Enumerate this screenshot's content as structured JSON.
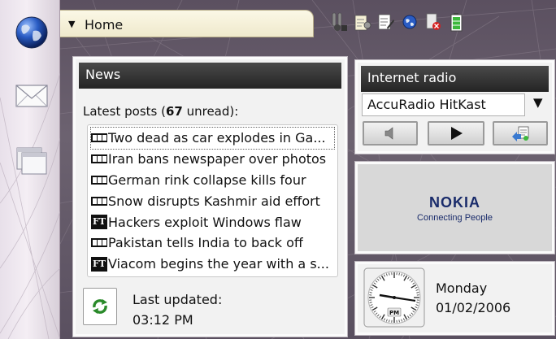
{
  "header": {
    "title": "Home"
  },
  "taskbar": {
    "items": [
      {
        "icon": "globe-icon"
      },
      {
        "icon": "mail-icon"
      },
      {
        "icon": "windows-icon"
      }
    ]
  },
  "toolbar": {
    "icons": [
      "connection-settings-icon",
      "device-settings-icon",
      "edit-icon",
      "globe-icon",
      "disconnect-icon",
      "battery-icon"
    ]
  },
  "news": {
    "title": "News",
    "latest_prefix": "Latest posts (",
    "unread_count": "67",
    "latest_suffix": " unread):",
    "items": [
      {
        "source": "BBC",
        "text": "Two dead as car explodes in Ga..."
      },
      {
        "source": "BBC",
        "text": "Iran bans newspaper over photos"
      },
      {
        "source": "BBC",
        "text": "German rink collapse kills four"
      },
      {
        "source": "BBC",
        "text": "Snow disrupts Kashmir aid effort"
      },
      {
        "source": "FT",
        "text": "Hackers exploit Windows flaw"
      },
      {
        "source": "BBC",
        "text": "Pakistan tells India to back off"
      },
      {
        "source": "FT",
        "text": "Viacom begins the year with a s..."
      }
    ],
    "updated_label": "Last updated:",
    "updated_time": "03:12 PM"
  },
  "radio": {
    "title": "Internet radio",
    "station": "AccuRadio HitKast"
  },
  "nokia": {
    "brand": "NOKIA",
    "tagline": "Connecting People"
  },
  "clock": {
    "meridiem": "PM",
    "day": "Monday",
    "date": "01/02/2006"
  },
  "colors": {
    "panel_header": "#2b2b2b",
    "title_tab": "#f6f2dc",
    "brand": "#1a2c6b"
  }
}
